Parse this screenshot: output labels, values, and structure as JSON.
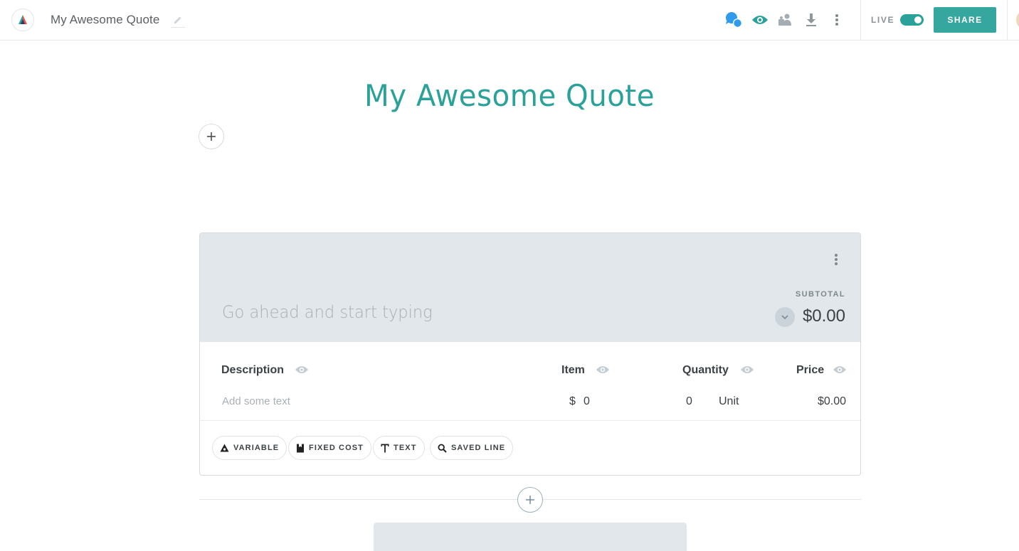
{
  "topbar": {
    "doc_title": "My Awesome Quote",
    "icons": [
      "chat-bubbles-icon",
      "eye-icon",
      "users-icon",
      "download-icon",
      "more-vertical-icon"
    ],
    "live_label": "LIVE",
    "live_enabled": true,
    "share_label": "SHARE"
  },
  "page": {
    "title": "My Awesome Quote"
  },
  "quote_block": {
    "placeholder": "Go ahead and start typing",
    "subtotal_label": "SUBTOTAL",
    "subtotal_value": "$0.00",
    "columns": {
      "description": "Description",
      "item": "Item",
      "quantity": "Quantity",
      "price": "Price"
    },
    "row": {
      "description_placeholder": "Add some text",
      "currency": "$",
      "item_value": "0",
      "quantity_value": "0",
      "unit": "Unit",
      "price_value": "$0.00"
    },
    "add_buttons": {
      "variable": "VARIABLE",
      "fixed_cost": "FIXED COST",
      "text": "TEXT",
      "saved_line": "SAVED LINE"
    }
  },
  "colors": {
    "accent": "#2aa199",
    "share": "#36a79e",
    "header_bg": "#e1e7eb",
    "chat_blue": "#2f9bea"
  }
}
